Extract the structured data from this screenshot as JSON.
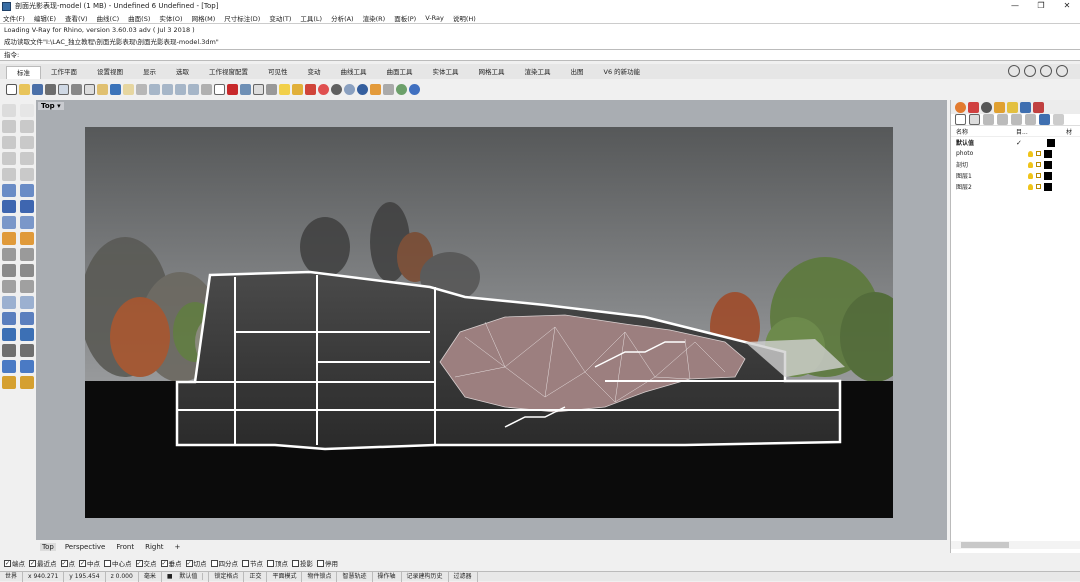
{
  "window": {
    "title": "剖面光影表现-model (1 MB) - Undefined 6 Undefined - [Top]",
    "minimize": "—",
    "maximize": "❐",
    "close": "✕"
  },
  "menu": [
    "文件(F)",
    "编辑(E)",
    "查看(V)",
    "曲线(C)",
    "曲面(S)",
    "实体(O)",
    "网格(M)",
    "尺寸标注(D)",
    "变动(T)",
    "工具(L)",
    "分析(A)",
    "渲染(R)",
    "面板(P)",
    "V-Ray",
    "说明(H)"
  ],
  "command_log": {
    "line1": "Loading V-Ray for Rhino, version 3.60.03 adv ( Jul  3 2018 )",
    "line2": "成功读取文件\"I:\\LAC_独立教程\\剖面光影表现\\剖面光影表现-model.3dm\""
  },
  "command_prompt": "指令:",
  "tabs": [
    "标准",
    "工作平面",
    "设置视图",
    "显示",
    "选取",
    "工作视窗配置",
    "可见性",
    "变动",
    "曲线工具",
    "曲面工具",
    "实体工具",
    "网格工具",
    "渲染工具",
    "出图",
    "V6 的新功能"
  ],
  "active_tab": "标准",
  "viewport": {
    "label": "Top",
    "label_arrow": "▾"
  },
  "viewport_tabs": [
    "Top",
    "Perspective",
    "Front",
    "Right",
    "+"
  ],
  "osnaps": [
    {
      "label": "端点",
      "checked": true
    },
    {
      "label": "最近点",
      "checked": true
    },
    {
      "label": "点",
      "checked": true
    },
    {
      "label": "中点",
      "checked": true
    },
    {
      "label": "中心点",
      "checked": false
    },
    {
      "label": "交点",
      "checked": true
    },
    {
      "label": "垂点",
      "checked": true
    },
    {
      "label": "切点",
      "checked": true
    },
    {
      "label": "四分点",
      "checked": false
    },
    {
      "label": "节点",
      "checked": false
    },
    {
      "label": "顶点",
      "checked": false
    },
    {
      "label": "投影",
      "checked": false
    },
    {
      "label": "停用",
      "checked": false
    }
  ],
  "status": {
    "cplane": "世界",
    "x": "x 940.271",
    "y": "y 195.454",
    "z": "z 0.000",
    "units": "毫米",
    "layer": "默认值",
    "toggles": [
      "锁定格点",
      "正交",
      "平面模式",
      "物件锁点",
      "智慧轨迹",
      "操作轴",
      "记录建构历史",
      "过滤器"
    ]
  },
  "layers_panel": {
    "col_name": "名称",
    "col_other": "目...",
    "col_mat": "材",
    "rows": [
      {
        "name": "默认值",
        "current": "✓"
      },
      {
        "name": "photo",
        "current": ""
      },
      {
        "name": "剖切",
        "current": ""
      },
      {
        "name": "图层1",
        "current": ""
      },
      {
        "name": "图层2",
        "current": ""
      }
    ]
  },
  "colors": {
    "viewport_bg": "#a9adb2",
    "ground": "#0b0b0b",
    "sky_top": "#5a5c5e",
    "sky_bottom": "#a7a9ab",
    "cave_pink": "#9c7f7f"
  }
}
